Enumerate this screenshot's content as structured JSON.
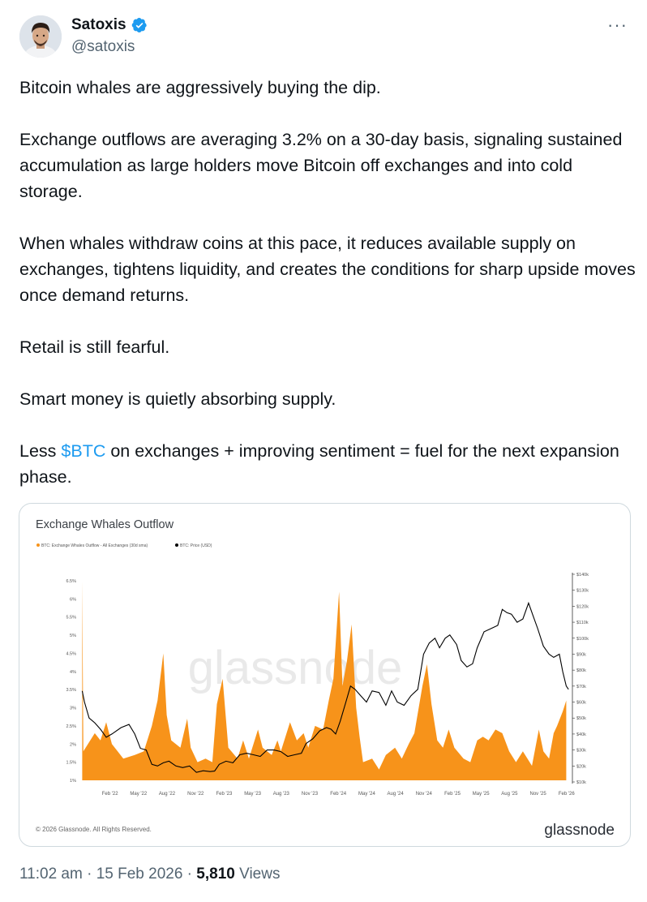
{
  "author": {
    "name": "Satoxis",
    "handle": "@satoxis"
  },
  "more_label": "···",
  "tweet": {
    "p1": "Bitcoin whales are aggressively buying the dip.",
    "p2": "Exchange outflows are averaging 3.2% on a 30-day basis, signaling sustained accumulation as large holders move Bitcoin off exchanges and into cold storage.",
    "p3": "When whales withdraw coins at this pace, it reduces available supply on exchanges, tightens liquidity, and creates the conditions for sharp upside moves once demand returns.",
    "p4": "Retail is still fearful.",
    "p5": "Smart money is quietly absorbing supply.",
    "p6_before": "Less ",
    "p6_cashtag": "$BTC",
    "p6_after": " on exchanges + improving sentiment = fuel for the next expansion phase."
  },
  "meta": {
    "time": "11:02 am",
    "sep": " · ",
    "date": "15 Feb 2026",
    "views_count": "5,810",
    "views_label": " Views"
  },
  "chart_data": {
    "type": "area",
    "title": "Exchange Whales Outflow",
    "watermark": "glassnode",
    "brand": "glassnode",
    "copyright": "© 2026 Glassnode. All Rights Reserved.",
    "left_axis_ticks": [
      "6.5%",
      "6%",
      "5.5%",
      "5%",
      "4.5%",
      "4%",
      "3.5%",
      "3%",
      "2.5%",
      "2%",
      "1.5%",
      "1%"
    ],
    "left_axis_values": [
      6.5,
      6,
      5.5,
      5,
      4.5,
      4,
      3.5,
      3,
      2.5,
      2,
      1.5,
      1
    ],
    "right_axis_ticks": [
      "$140k",
      "$130k",
      "$120k",
      "$110k",
      "$100k",
      "$90k",
      "$80k",
      "$70k",
      "$60k",
      "$50k",
      "$40k",
      "$30k",
      "$20k",
      "$10k"
    ],
    "right_axis_values": [
      140,
      130,
      120,
      110,
      100,
      90,
      80,
      70,
      60,
      50,
      40,
      30,
      20,
      10
    ],
    "x_ticks": [
      "Feb '22",
      "May '22",
      "Aug '22",
      "Nov '22",
      "Feb '23",
      "May '23",
      "Aug '23",
      "Nov '23",
      "Feb '24",
      "May '24",
      "Aug '24",
      "Nov '24",
      "Feb '25",
      "May '25",
      "Aug '25",
      "Nov '25",
      "Feb '26"
    ],
    "x_tick_values": [
      2022.083,
      2022.333,
      2022.583,
      2022.833,
      2023.083,
      2023.333,
      2023.583,
      2023.833,
      2024.083,
      2024.333,
      2024.583,
      2024.833,
      2025.083,
      2025.333,
      2025.583,
      2025.833,
      2026.083
    ],
    "xlim": [
      2021.83,
      2026.12
    ],
    "ylim_left": [
      1,
      6.5
    ],
    "ylim_right": [
      10,
      140
    ],
    "series": [
      {
        "name": "BTC: Exchange Whales Outflow - All Exchanges (30d sma)",
        "color": "#f7931a",
        "axis": "left",
        "points": [
          [
            2021.84,
            6.5
          ],
          [
            2021.85,
            1.8
          ],
          [
            2021.95,
            2.3
          ],
          [
            2022.0,
            2.1
          ],
          [
            2022.05,
            2.6
          ],
          [
            2022.1,
            2.0
          ],
          [
            2022.15,
            1.8
          ],
          [
            2022.2,
            1.6
          ],
          [
            2022.3,
            1.7
          ],
          [
            2022.38,
            1.8
          ],
          [
            2022.45,
            2.5
          ],
          [
            2022.5,
            3.2
          ],
          [
            2022.55,
            4.5
          ],
          [
            2022.58,
            2.8
          ],
          [
            2022.62,
            2.1
          ],
          [
            2022.7,
            1.9
          ],
          [
            2022.76,
            2.7
          ],
          [
            2022.79,
            1.9
          ],
          [
            2022.85,
            1.5
          ],
          [
            2022.92,
            1.6
          ],
          [
            2022.98,
            1.5
          ],
          [
            2023.02,
            3.1
          ],
          [
            2023.07,
            3.8
          ],
          [
            2023.12,
            1.9
          ],
          [
            2023.2,
            1.6
          ],
          [
            2023.25,
            2.1
          ],
          [
            2023.3,
            1.6
          ],
          [
            2023.38,
            2.4
          ],
          [
            2023.42,
            1.9
          ],
          [
            2023.5,
            1.7
          ],
          [
            2023.55,
            2.1
          ],
          [
            2023.58,
            1.8
          ],
          [
            2023.66,
            2.6
          ],
          [
            2023.72,
            2.1
          ],
          [
            2023.78,
            2.3
          ],
          [
            2023.82,
            1.9
          ],
          [
            2023.88,
            2.5
          ],
          [
            2023.95,
            2.4
          ],
          [
            2024.0,
            3.2
          ],
          [
            2024.04,
            3.8
          ],
          [
            2024.09,
            6.2
          ],
          [
            2024.12,
            3.6
          ],
          [
            2024.16,
            4.3
          ],
          [
            2024.2,
            5.3
          ],
          [
            2024.24,
            3.0
          ],
          [
            2024.27,
            2.2
          ],
          [
            2024.3,
            1.5
          ],
          [
            2024.38,
            1.6
          ],
          [
            2024.44,
            1.3
          ],
          [
            2024.5,
            1.7
          ],
          [
            2024.58,
            1.9
          ],
          [
            2024.64,
            1.6
          ],
          [
            2024.7,
            2.0
          ],
          [
            2024.75,
            2.3
          ],
          [
            2024.82,
            3.6
          ],
          [
            2024.86,
            4.2
          ],
          [
            2024.9,
            3.1
          ],
          [
            2024.95,
            2.1
          ],
          [
            2025.0,
            1.9
          ],
          [
            2025.05,
            2.4
          ],
          [
            2025.1,
            1.9
          ],
          [
            2025.18,
            1.6
          ],
          [
            2025.24,
            1.5
          ],
          [
            2025.3,
            2.1
          ],
          [
            2025.35,
            2.2
          ],
          [
            2025.4,
            2.1
          ],
          [
            2025.46,
            2.4
          ],
          [
            2025.52,
            2.3
          ],
          [
            2025.58,
            1.8
          ],
          [
            2025.64,
            1.5
          ],
          [
            2025.7,
            1.8
          ],
          [
            2025.78,
            1.4
          ],
          [
            2025.84,
            2.4
          ],
          [
            2025.88,
            1.8
          ],
          [
            2025.93,
            1.6
          ],
          [
            2025.97,
            2.3
          ],
          [
            2026.0,
            2.5
          ],
          [
            2026.05,
            2.9
          ],
          [
            2026.08,
            3.2
          ]
        ]
      },
      {
        "name": "BTC: Price (USD)",
        "color": "#000000",
        "axis": "right",
        "points": [
          [
            2021.84,
            67
          ],
          [
            2021.86,
            60
          ],
          [
            2021.9,
            50
          ],
          [
            2021.95,
            47
          ],
          [
            2022.0,
            43
          ],
          [
            2022.05,
            38
          ],
          [
            2022.1,
            40
          ],
          [
            2022.18,
            44
          ],
          [
            2022.25,
            46
          ],
          [
            2022.3,
            40
          ],
          [
            2022.35,
            31
          ],
          [
            2022.4,
            30
          ],
          [
            2022.45,
            21
          ],
          [
            2022.5,
            20
          ],
          [
            2022.55,
            22
          ],
          [
            2022.6,
            23
          ],
          [
            2022.66,
            20
          ],
          [
            2022.72,
            19
          ],
          [
            2022.78,
            20
          ],
          [
            2022.84,
            16
          ],
          [
            2022.9,
            17
          ],
          [
            2022.96,
            16.5
          ],
          [
            2023.0,
            16.8
          ],
          [
            2023.04,
            21
          ],
          [
            2023.1,
            23
          ],
          [
            2023.16,
            22
          ],
          [
            2023.22,
            27
          ],
          [
            2023.28,
            28
          ],
          [
            2023.34,
            27
          ],
          [
            2023.4,
            26
          ],
          [
            2023.46,
            30
          ],
          [
            2023.52,
            30
          ],
          [
            2023.58,
            29
          ],
          [
            2023.64,
            26
          ],
          [
            2023.7,
            27
          ],
          [
            2023.76,
            28
          ],
          [
            2023.8,
            34
          ],
          [
            2023.86,
            37
          ],
          [
            2023.92,
            42
          ],
          [
            2023.98,
            44
          ],
          [
            2024.02,
            43
          ],
          [
            2024.06,
            40
          ],
          [
            2024.1,
            48
          ],
          [
            2024.15,
            60
          ],
          [
            2024.19,
            70
          ],
          [
            2024.23,
            68
          ],
          [
            2024.28,
            64
          ],
          [
            2024.33,
            60
          ],
          [
            2024.38,
            67
          ],
          [
            2024.44,
            66
          ],
          [
            2024.5,
            58
          ],
          [
            2024.55,
            67
          ],
          [
            2024.6,
            60
          ],
          [
            2024.66,
            58
          ],
          [
            2024.72,
            64
          ],
          [
            2024.78,
            68
          ],
          [
            2024.83,
            90
          ],
          [
            2024.88,
            97
          ],
          [
            2024.93,
            100
          ],
          [
            2024.97,
            94
          ],
          [
            2025.02,
            100
          ],
          [
            2025.06,
            102
          ],
          [
            2025.12,
            96
          ],
          [
            2025.16,
            86
          ],
          [
            2025.21,
            82
          ],
          [
            2025.26,
            84
          ],
          [
            2025.3,
            94
          ],
          [
            2025.36,
            104
          ],
          [
            2025.42,
            106
          ],
          [
            2025.48,
            108
          ],
          [
            2025.52,
            118
          ],
          [
            2025.56,
            116
          ],
          [
            2025.6,
            115
          ],
          [
            2025.65,
            110
          ],
          [
            2025.7,
            112
          ],
          [
            2025.75,
            122
          ],
          [
            2025.79,
            114
          ],
          [
            2025.83,
            106
          ],
          [
            2025.88,
            95
          ],
          [
            2025.93,
            90
          ],
          [
            2025.97,
            88
          ],
          [
            2026.02,
            90
          ],
          [
            2026.05,
            79
          ],
          [
            2026.08,
            70
          ],
          [
            2026.1,
            68
          ]
        ]
      }
    ]
  }
}
